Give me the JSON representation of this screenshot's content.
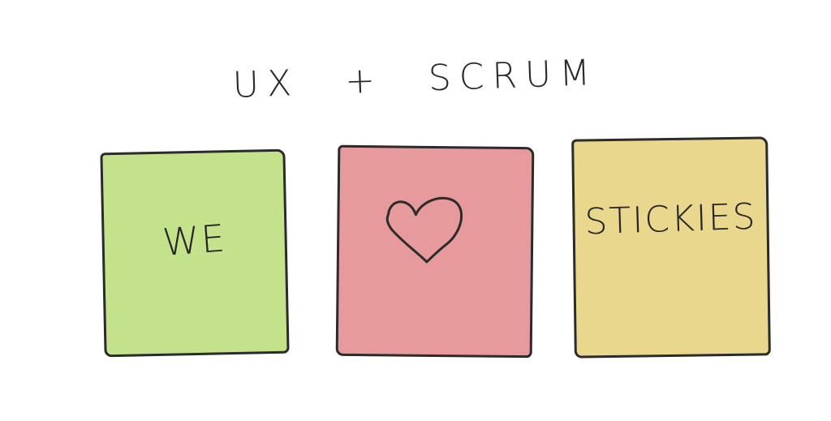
{
  "title": {
    "left": "UX",
    "plus": "+",
    "right": "SCRUM"
  },
  "notes": [
    {
      "label": "WE",
      "color": "#c4e18c"
    },
    {
      "label": "",
      "icon": "heart-icon",
      "color": "#e69a9c"
    },
    {
      "label": "STICKIES",
      "color": "#e8d78c"
    }
  ]
}
